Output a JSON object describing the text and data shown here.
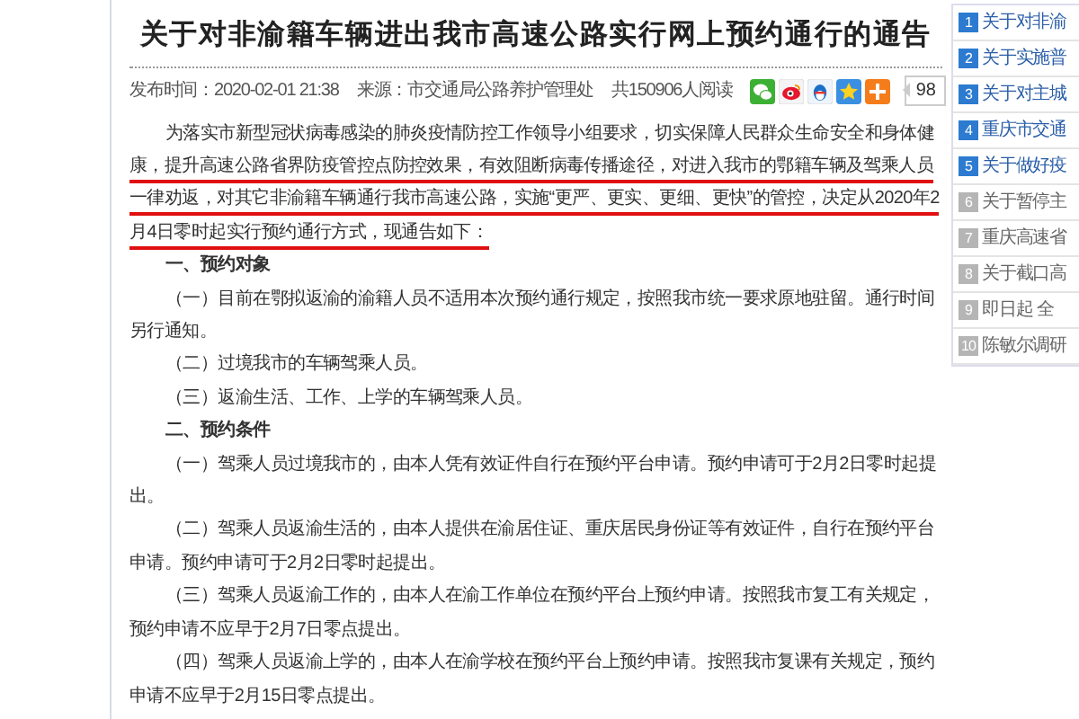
{
  "article": {
    "title": "关于对非渝籍车辆进出我市高速公路实行网上预约通行的通告",
    "meta": {
      "published": "发布时间：2020-02-01 21:38",
      "source": "来源：市交通局公路养护管理处",
      "reads": "共150906人阅读"
    },
    "share": {
      "count": "98"
    },
    "paragraphs": [
      {
        "kind": "body",
        "segments": [
          {
            "text": "为落实市新型冠状病毒感染的肺炎疫情防控工作领导小组要求，切实保障人民群众生命安全和身体健",
            "marked": false
          },
          {
            "text": "康，提升高速公路省界防疫管控点防控效果，有效阻断病毒传播途径，对进入我市的鄂籍车辆及驾乘人员一律劝返，对其它非渝籍车辆通行我市高速公路，实施“更严、更实、更细、更快”的管控，决定从2020年2月4日零时起实行预约通行方式，现通告如下：",
            "marked": true
          }
        ]
      },
      {
        "kind": "heading",
        "text": "一、预约对象"
      },
      {
        "kind": "body",
        "text": "（一）目前在鄂拟返渝的渝籍人员不适用本次预约通行规定，按照我市统一要求原地驻留。通行时间另行通知。"
      },
      {
        "kind": "body",
        "text": "（二）过境我市的车辆驾乘人员。"
      },
      {
        "kind": "body",
        "text": "（三）返渝生活、工作、上学的车辆驾乘人员。"
      },
      {
        "kind": "heading",
        "text": "二、预约条件"
      },
      {
        "kind": "body",
        "text": "（一）驾乘人员过境我市的，由本人凭有效证件自行在预约平台申请。预约申请可于2月2日零时起提出。"
      },
      {
        "kind": "body",
        "text": "（二）驾乘人员返渝生活的，由本人提供在渝居住证、重庆居民身份证等有效证件，自行在预约平台申请。预约申请可于2月2日零时起提出。"
      },
      {
        "kind": "body",
        "text": "（三）驾乘人员返渝工作的，由本人在渝工作单位在预约平台上预约申请。按照我市复工有关规定，预约申请不应早于2月7日零点提出。"
      },
      {
        "kind": "body",
        "text": "（四）驾乘人员返渝上学的，由本人在渝学校在预约平台上预约申请。按照我市复课有关规定，预约申请不应早于2月15日零点提出。"
      }
    ]
  },
  "sidebar": {
    "items": [
      {
        "rank": "1",
        "title": "关于对非渝",
        "highlighted": true
      },
      {
        "rank": "2",
        "title": "关于实施普",
        "highlighted": true
      },
      {
        "rank": "3",
        "title": "关于对主城",
        "highlighted": true
      },
      {
        "rank": "4",
        "title": "重庆市交通",
        "highlighted": true
      },
      {
        "rank": "5",
        "title": "关于做好疫",
        "highlighted": true
      },
      {
        "rank": "6",
        "title": "关于暂停主",
        "highlighted": false
      },
      {
        "rank": "7",
        "title": "重庆高速省",
        "highlighted": false
      },
      {
        "rank": "8",
        "title": "关于截口高",
        "highlighted": false
      },
      {
        "rank": "9",
        "title": "即日起 全",
        "highlighted": false
      },
      {
        "rank": "10",
        "title": "陈敏尔调研",
        "highlighted": false
      }
    ]
  }
}
